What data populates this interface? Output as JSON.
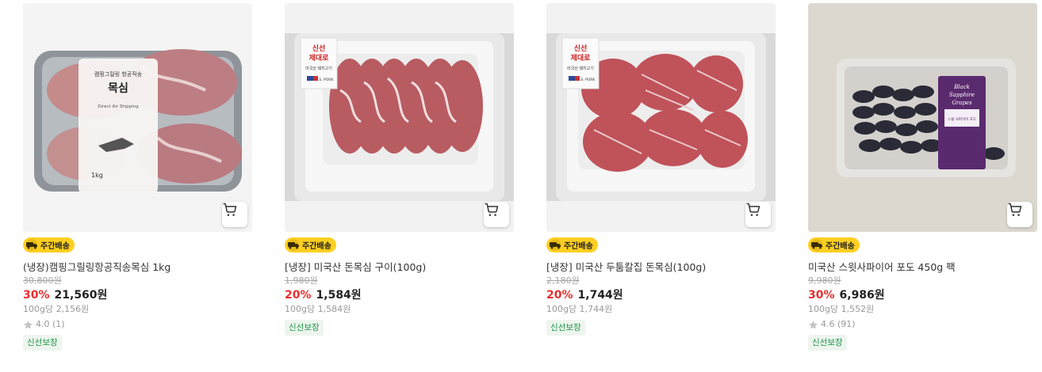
{
  "products": [
    {
      "image_alt": "캠핑그릴링 항공직송 목심 1kg 패키지",
      "badge": "주간배송",
      "name": "(냉장)캠핑그릴링항공직송목심 1kg",
      "original_price": "30,800원",
      "discount": "30%",
      "price": "21,560원",
      "unit_price": "100g당 2,156원",
      "rating": "4.0 (1)",
      "tag": "신선보장",
      "package_text": {
        "line1": "캠핑그릴링 항공직송",
        "title": "목심",
        "sub": "Direct Air Shipping",
        "weight": "1kg"
      }
    },
    {
      "image_alt": "미국산 돈목심 구이",
      "badge": "주간배송",
      "name": "[냉장] 미국산 돈목심 구이(100g)",
      "original_price": "1,980원",
      "discount": "20%",
      "price": "1,584원",
      "unit_price": "100g당 1,584원",
      "tag": "신선보장",
      "label_text": {
        "brand": "신선\n제대로",
        "sub": "미국산 돼지고기",
        "origin": "U.S. PORK"
      }
    },
    {
      "image_alt": "미국산 두툼칼집 돈목심",
      "badge": "주간배송",
      "name": "[냉장] 미국산 두툼칼집 돈목심(100g)",
      "original_price": "2,180원",
      "discount": "20%",
      "price": "1,744원",
      "unit_price": "100g당 1,744원",
      "tag": "신선보장",
      "label_text": {
        "brand": "신선\n제대로",
        "sub": "미국산 돼지고기",
        "origin": "U.S. PORK"
      }
    },
    {
      "image_alt": "미국산 스윗사파이어 포도 450g 팩",
      "badge": "주간배송",
      "name": "미국산 스윗사파이어 포도 450g 팩",
      "original_price": "9,980원",
      "discount": "30%",
      "price": "6,986원",
      "unit_price": "100g당 1,552원",
      "rating": "4.6 (91)",
      "tag": "신선보장",
      "label_text": {
        "title": "Black Sapphire Grapes",
        "sub": "스윗 사파이어 포도"
      }
    }
  ],
  "colors": {
    "discount": "#ea2e2e",
    "badge_bg": "#ffcf20",
    "fresh_text": "#1b9543",
    "fresh_bg": "#eef5ef"
  },
  "icons": {
    "cart": "cart-icon",
    "truck": "truck-icon",
    "star": "star-icon"
  }
}
